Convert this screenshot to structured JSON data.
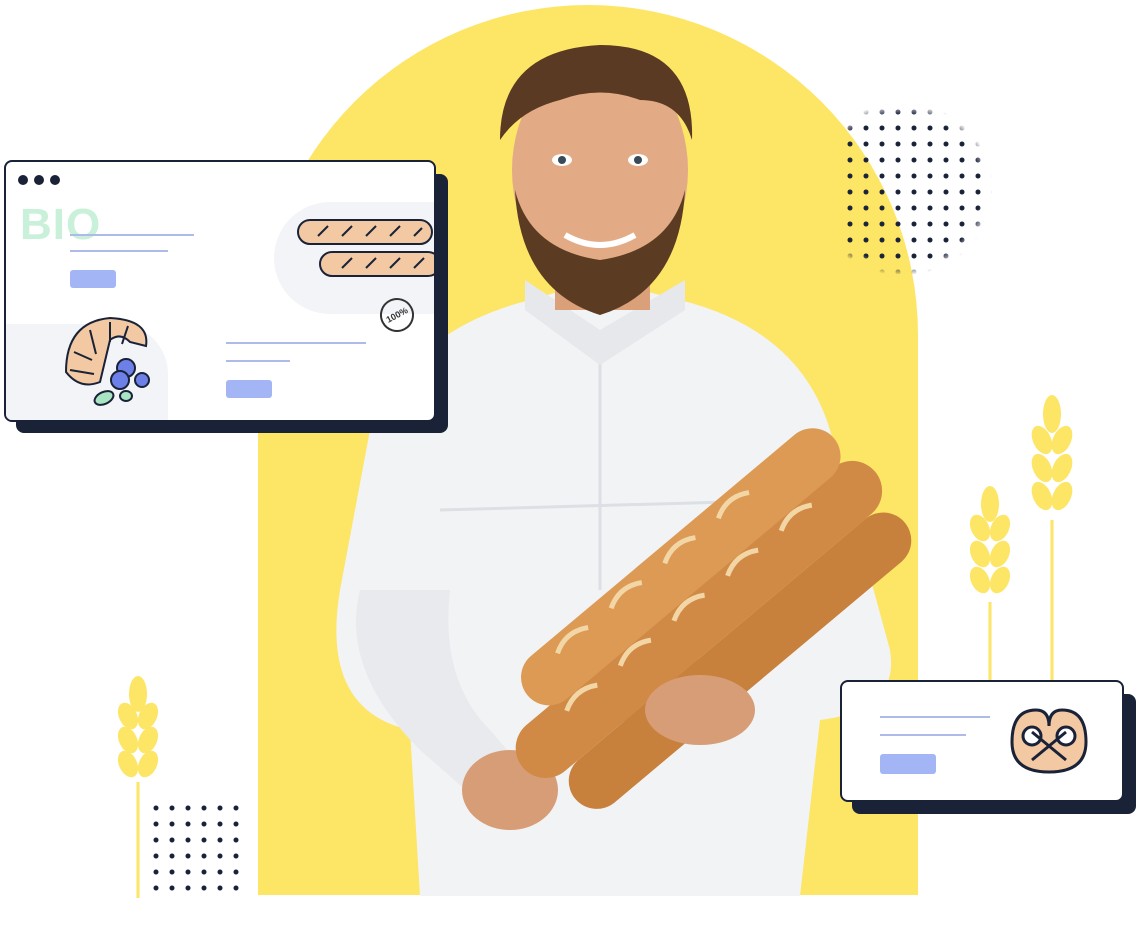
{
  "bio_card": {
    "watermark": "BIO",
    "badge": "100%"
  },
  "icons": {
    "baguette": "baguette-icon",
    "croissant": "croissant-icon",
    "pretzel": "pretzel-icon",
    "wheat": "wheat-icon"
  },
  "colors": {
    "arch": "#fde566",
    "dark": "#1a2238",
    "accent_blue": "#a4b5f5",
    "bio_green": "#c9f0d9"
  }
}
